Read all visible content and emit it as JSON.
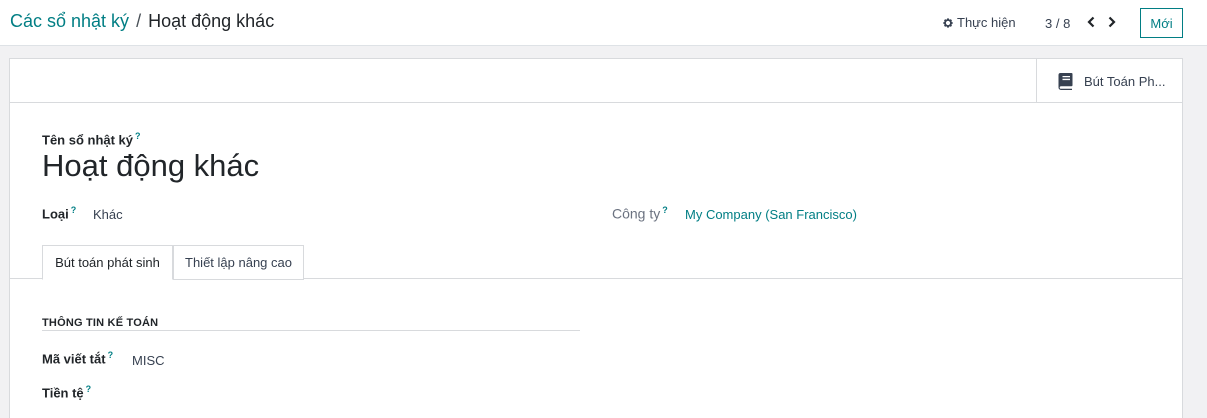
{
  "breadcrumb": {
    "parent": "Các sổ nhật ký",
    "separator": "/",
    "current": "Hoạt động khác"
  },
  "toolbar": {
    "action_label": "Thực hiện",
    "action_icon": "gear-icon",
    "pager_text": "3 / 8",
    "new_label": "Mới"
  },
  "smart_button": {
    "label": "Bút Toán Ph...",
    "icon": "book-icon"
  },
  "form": {
    "name_label": "Tên sổ nhật ký",
    "help_mark": "?",
    "title": "Hoạt động khác",
    "type_label": "Loại",
    "type_value": "Khác",
    "company_label": "Công ty",
    "company_value": "My Company (San Francisco)"
  },
  "tabs": [
    {
      "label": "Bút toán phát sinh",
      "active": true
    },
    {
      "label": "Thiết lập nâng cao",
      "active": false
    }
  ],
  "accounting": {
    "group_title": "THÔNG TIN KẾ TOÁN",
    "code_label": "Mã viết tắt",
    "code_value": "MISC",
    "currency_label": "Tiền tệ"
  },
  "colors": {
    "accent": "#017e84",
    "background": "#f1f1f3",
    "border": "#d8dadd"
  }
}
